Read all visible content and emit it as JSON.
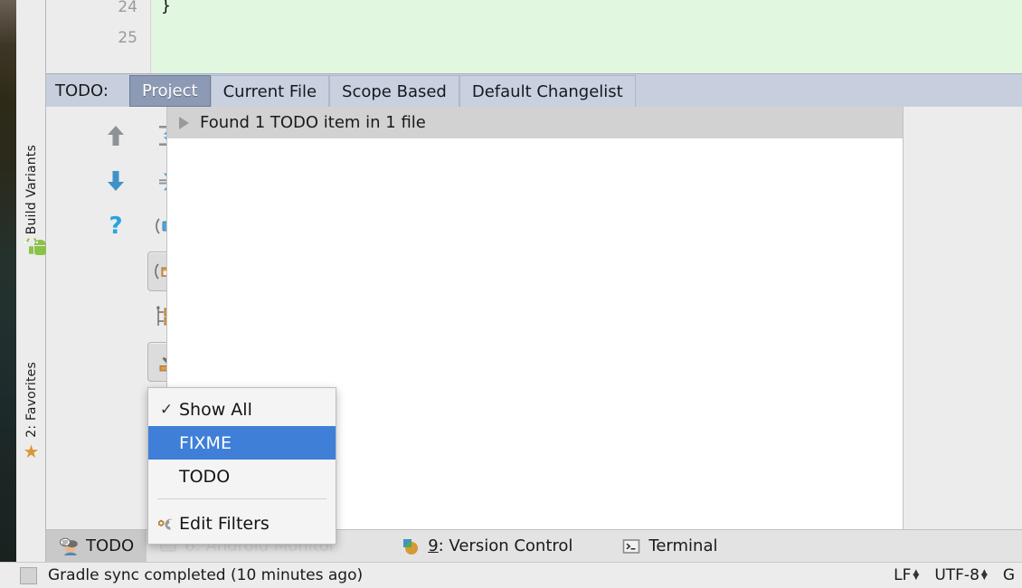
{
  "editor": {
    "line_numbers": [
      "24",
      "25"
    ],
    "code_text": "}",
    "code_background": "#e2f7e0"
  },
  "left_tool_strip": {
    "items": [
      {
        "label": "Build Variants",
        "icon": "android-robot-icon"
      },
      {
        "label": "2: Favorites",
        "icon": "star-icon",
        "mnemonic": "2"
      }
    ]
  },
  "todo_panel": {
    "title": "TODO:",
    "tabs": [
      {
        "label": "Project",
        "selected": true
      },
      {
        "label": "Current File",
        "selected": false
      },
      {
        "label": "Scope Based",
        "selected": false
      },
      {
        "label": "Default Changelist",
        "selected": false
      }
    ],
    "result_header": "Found 1 TODO item in 1 file",
    "toolbar_buttons": [
      {
        "name": "previous-occurrence-button",
        "icon": "arrow-up-icon",
        "active": false
      },
      {
        "name": "expand-all-button",
        "icon": "expand-all-icon",
        "active": false
      },
      {
        "name": "next-occurrence-button",
        "icon": "arrow-down-icon",
        "active": false
      },
      {
        "name": "collapse-all-button",
        "icon": "collapse-all-icon",
        "active": false
      },
      {
        "name": "help-button",
        "icon": "question-mark-icon",
        "active": false
      },
      {
        "name": "group-by-module-button",
        "icon": "module-group-icon",
        "active": false
      },
      {
        "name": "group-by-package-button",
        "icon": "folder-group-icon",
        "active": true
      },
      {
        "name": "flatten-packages-button",
        "icon": "package-tree-icon",
        "active": false
      },
      {
        "name": "autoscroll-to-source-button",
        "icon": "autoscroll-down-icon",
        "active": true
      },
      {
        "name": "filter-todo-button",
        "icon": "funnel-filter-icon",
        "active": false
      },
      {
        "name": "preview-source-button",
        "icon": "preview-panel-icon",
        "active": true
      }
    ]
  },
  "context_menu": {
    "items": [
      {
        "label": "Show All",
        "checked": true,
        "highlighted": false,
        "icon": "checkmark-icon"
      },
      {
        "label": "FIXME",
        "checked": false,
        "highlighted": true,
        "icon": null
      },
      {
        "label": "TODO",
        "checked": false,
        "highlighted": false,
        "icon": null
      }
    ],
    "separator_after": 3,
    "footer_item": {
      "label": "Edit Filters",
      "icon": "wrench-gear-icon"
    },
    "highlight_color": "#3f7fd8"
  },
  "bottom_tool_bar": {
    "tabs": [
      {
        "label": "TODO",
        "icon": "todo-person-icon",
        "selected": true,
        "mnemonic": null
      },
      {
        "label": "6: Android Monitor",
        "icon": "android-monitor-icon",
        "selected": false,
        "mnemonic": "6"
      },
      {
        "label": "9: Version Control",
        "icon": "version-control-icon",
        "selected": false,
        "mnemonic": "9"
      },
      {
        "label": "Terminal",
        "icon": "terminal-icon",
        "selected": false,
        "mnemonic": null
      }
    ]
  },
  "status_bar": {
    "message": "Gradle sync completed (10 minutes ago)",
    "indicators": [
      {
        "label": "LF",
        "has_chevrons": true
      },
      {
        "label": "UTF-8",
        "has_chevrons": true
      },
      {
        "label": "G",
        "has_chevrons": false
      }
    ]
  }
}
